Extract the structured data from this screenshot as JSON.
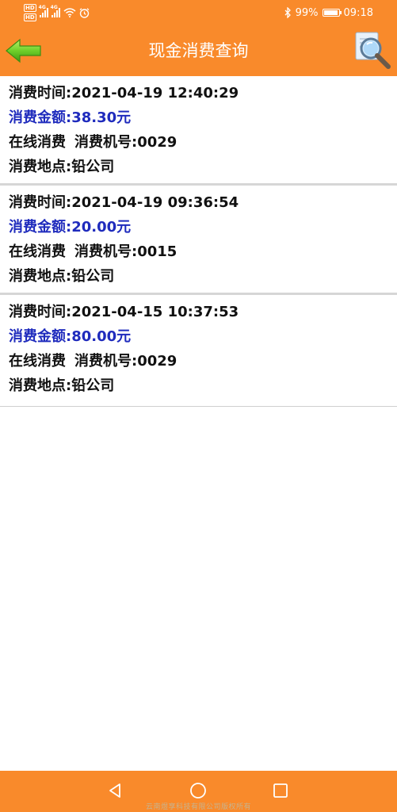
{
  "status_bar": {
    "hd_badges": [
      "HD",
      "HD"
    ],
    "signal_labels": [
      "4G",
      "4G"
    ],
    "battery_percent": "99%",
    "time": "09:18"
  },
  "header": {
    "title": "现金消费查询",
    "back_icon": "green-left-arrow-icon",
    "search_icon": "magnifier-icon"
  },
  "records": [
    {
      "time": "消费时间:2021-04-19 12:40:29",
      "amount": "消费金额:38.30元",
      "type": "在线消费",
      "machine": "消费机号:0029",
      "location": "消费地点:铅公司"
    },
    {
      "time": "消费时间:2021-04-19 09:36:54",
      "amount": "消费金额:20.00元",
      "type": "在线消费",
      "machine": "消费机号:0015",
      "location": "消费地点:铅公司"
    },
    {
      "time": "消费时间:2021-04-15 10:37:53",
      "amount": "消费金额:80.00元",
      "type": "在线消费",
      "machine": "消费机号:0029",
      "location": "消费地点:铅公司"
    }
  ],
  "nav": {
    "back_icon": "triangle-back-icon",
    "home_icon": "circle-home-icon",
    "recent_icon": "square-recent-icon"
  },
  "footer": {
    "copyright": "云南煜享科技有限公司版权所有"
  },
  "colors": {
    "accent": "#f98a2b",
    "amount_text": "#1f2bbd",
    "divider": "#d6d6d6"
  }
}
